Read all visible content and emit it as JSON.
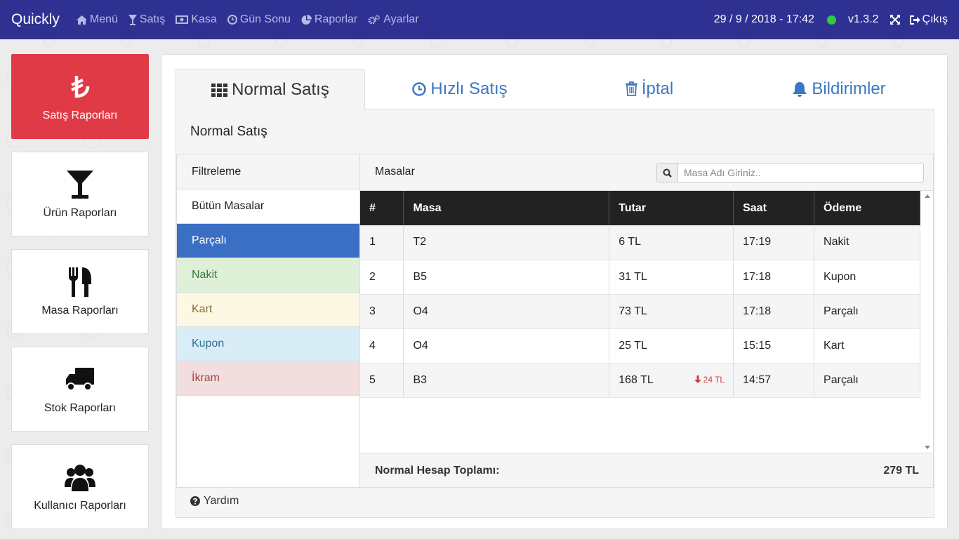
{
  "nav": {
    "brand": "Quickly",
    "items": [
      {
        "label": "Menü",
        "icon": "home-icon"
      },
      {
        "label": "Satış",
        "icon": "glass-icon"
      },
      {
        "label": "Kasa",
        "icon": "money-icon"
      },
      {
        "label": "Gün Sonu",
        "icon": "clock-icon"
      },
      {
        "label": "Raporlar",
        "icon": "pie-chart-icon"
      },
      {
        "label": "Ayarlar",
        "icon": "gears-icon"
      }
    ],
    "datetime": "29 / 9 / 2018 - 17:42",
    "status_color": "#2ecc40",
    "version": "v1.3.2",
    "logout": "Çıkış"
  },
  "sidebar": {
    "items": [
      {
        "label": "Satış Raporları",
        "icon": "lira-icon",
        "active": true
      },
      {
        "label": "Ürün Raporları",
        "icon": "cocktail-glass-icon"
      },
      {
        "label": "Masa Raporları",
        "icon": "cutlery-icon"
      },
      {
        "label": "Stok Raporları",
        "icon": "truck-icon"
      },
      {
        "label": "Kullanıcı Raporları",
        "icon": "users-icon"
      }
    ]
  },
  "tabs": [
    {
      "label": "Normal Satış",
      "icon": "grid-icon",
      "active": true
    },
    {
      "label": "Hızlı Satış",
      "icon": "clock-icon"
    },
    {
      "label": "İptal",
      "icon": "trash-icon"
    },
    {
      "label": "Bildirimler",
      "icon": "bell-icon"
    }
  ],
  "panel": {
    "title": "Normal Satış",
    "help": "Yardım"
  },
  "filter": {
    "header": "Filtreleme",
    "items": [
      {
        "label": "Bütün Masalar",
        "bg": "#ffffff",
        "color": "#222222"
      },
      {
        "label": "Parçalı",
        "bg": "#3a6fc4",
        "color": "#ffffff"
      },
      {
        "label": "Nakit",
        "bg": "#dff0d8",
        "color": "#3c763d"
      },
      {
        "label": "Kart",
        "bg": "#fcf8e3",
        "color": "#8a6d3b"
      },
      {
        "label": "Kupon",
        "bg": "#d9edf7",
        "color": "#31708f"
      },
      {
        "label": "İkram",
        "bg": "#f2dede",
        "color": "#a94442"
      }
    ]
  },
  "tables": {
    "header": "Masalar",
    "search_placeholder": "Masa Adı Giriniz..",
    "columns": [
      "#",
      "Masa",
      "Tutar",
      "Saat",
      "Ödeme"
    ],
    "rows": [
      {
        "no": "1",
        "masa": "T2",
        "tutar": "6 TL",
        "discount": "",
        "saat": "17:19",
        "odeme": "Nakit"
      },
      {
        "no": "2",
        "masa": "B5",
        "tutar": "31 TL",
        "discount": "",
        "saat": "17:18",
        "odeme": "Kupon"
      },
      {
        "no": "3",
        "masa": "O4",
        "tutar": "73 TL",
        "discount": "",
        "saat": "17:18",
        "odeme": "Parçalı"
      },
      {
        "no": "4",
        "masa": "O4",
        "tutar": "25 TL",
        "discount": "",
        "saat": "15:15",
        "odeme": "Kart"
      },
      {
        "no": "5",
        "masa": "B3",
        "tutar": "168 TL",
        "discount": "24 TL",
        "saat": "14:57",
        "odeme": "Parçalı"
      }
    ],
    "total_label": "Normal Hesap Toplamı:",
    "total_value": "279 TL"
  }
}
